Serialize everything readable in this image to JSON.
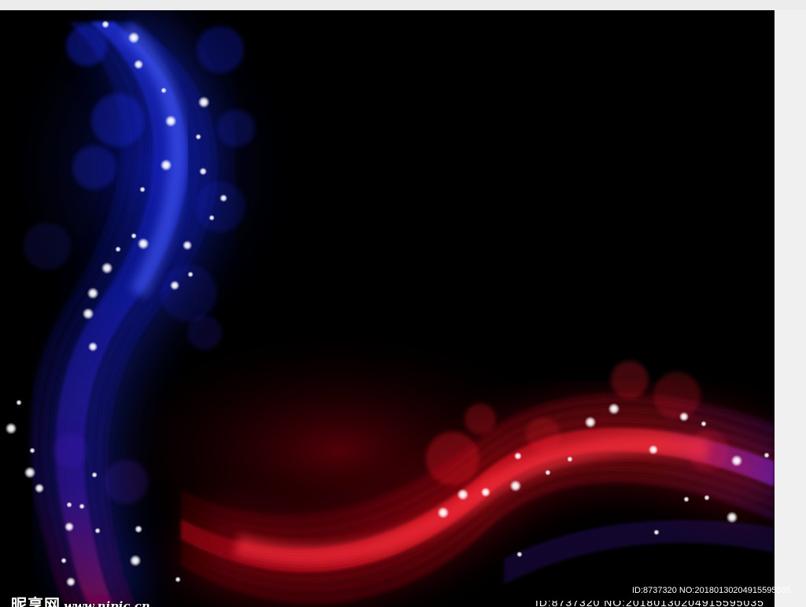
{
  "image": {
    "subject": "abstract glowing blue and red wavy light ribbons with bokeh sparkles on black background",
    "colors": {
      "background": "#000000",
      "blue_ribbon": "#1a2cff",
      "red_ribbon": "#ff1020",
      "purple_glow": "#7a2cff",
      "sparkle": "#ffffff"
    }
  },
  "watermark": {
    "site_name": "昵享网",
    "url": "www.nipic.cn"
  },
  "id_text": "ID:8737320 NO:20180130204915595035"
}
